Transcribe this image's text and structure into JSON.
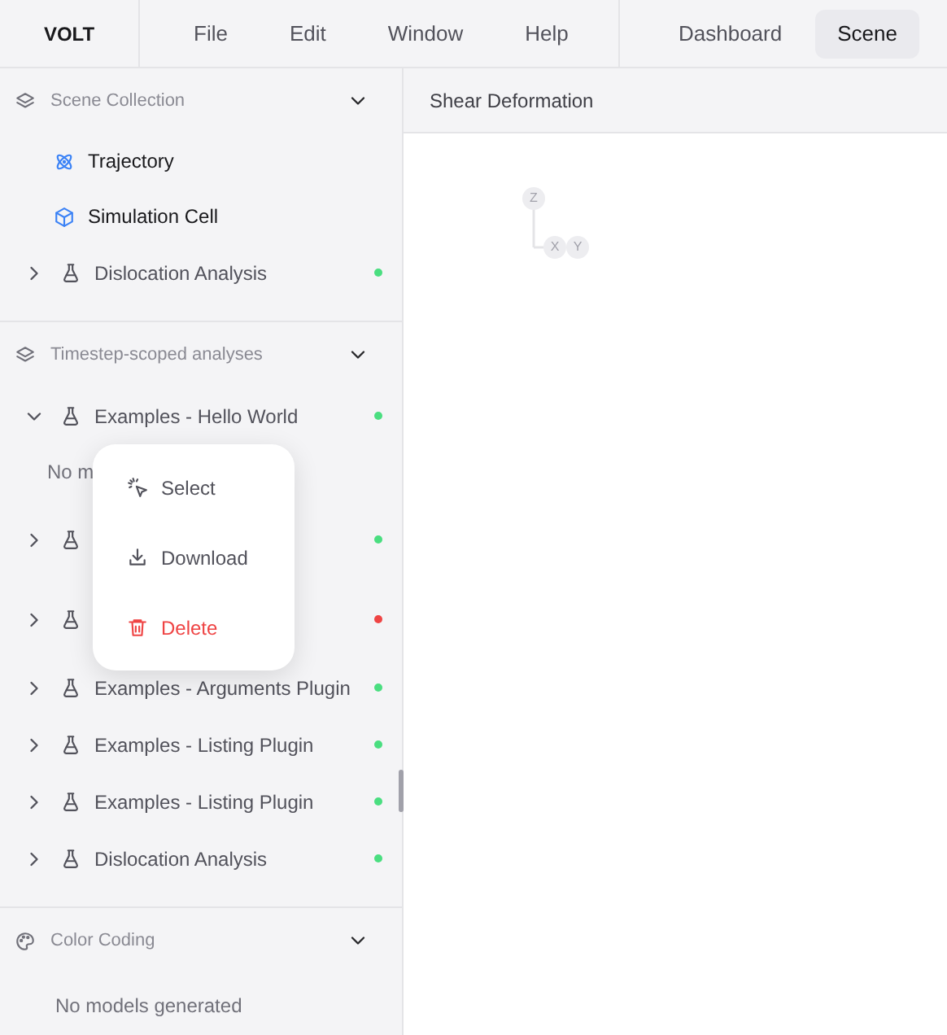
{
  "header": {
    "logo": "VOLT",
    "menu": [
      "File",
      "Edit",
      "Window",
      "Help"
    ],
    "views": [
      {
        "label": "Dashboard",
        "selected": false
      },
      {
        "label": "Scene",
        "selected": true
      }
    ]
  },
  "sidebar": {
    "sections": [
      {
        "title": "Scene Collection",
        "expanded": true,
        "items": [
          {
            "kind": "trajectory",
            "label": "Trajectory"
          },
          {
            "kind": "cell",
            "label": "Simulation Cell"
          },
          {
            "kind": "analysis",
            "label": "Dislocation Analysis",
            "expanded": false,
            "color": "#4ade80"
          }
        ]
      },
      {
        "title": "Timestep-scoped analyses",
        "expanded": true,
        "items": [
          {
            "kind": "analysis",
            "label": "Examples - Hello World",
            "expanded": true,
            "color": "#4ade80",
            "note": "No m"
          },
          {
            "kind": "analysis",
            "expanded": false,
            "color": "#4ade80"
          },
          {
            "kind": "analysis",
            "expanded": false,
            "color": "#ef4444"
          },
          {
            "kind": "analysis",
            "label": "Examples - Arguments Plugin",
            "expanded": false,
            "color": "#4ade80"
          },
          {
            "kind": "analysis",
            "label": "Examples - Listing Plugin",
            "expanded": false,
            "color": "#4ade80"
          },
          {
            "kind": "analysis",
            "label": "Examples - Listing Plugin",
            "expanded": false,
            "color": "#4ade80"
          },
          {
            "kind": "analysis",
            "label": "Dislocation Analysis",
            "expanded": false,
            "color": "#4ade80"
          }
        ]
      },
      {
        "title": "Color Coding",
        "expanded": true,
        "note": "No models generated"
      }
    ]
  },
  "context_menu": [
    {
      "kind": "select",
      "label": "Select"
    },
    {
      "kind": "download",
      "label": "Download"
    },
    {
      "kind": "delete",
      "label": "Delete"
    }
  ],
  "viewport": {
    "title": "Shear Deformation",
    "axes": [
      "Z",
      "X",
      "Y"
    ]
  }
}
